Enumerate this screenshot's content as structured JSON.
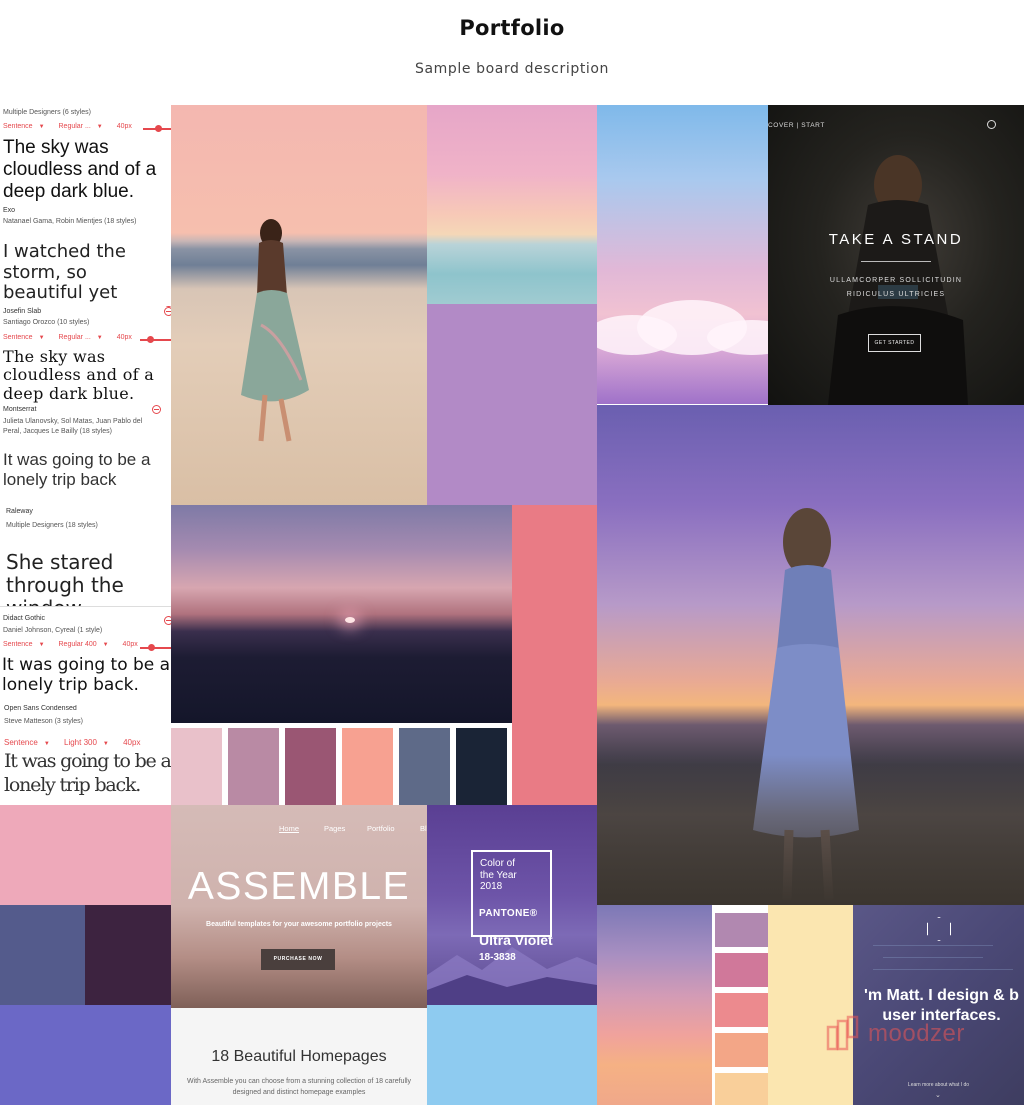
{
  "board": {
    "title": "Portfolio",
    "description": "Sample board description"
  },
  "font_panel": {
    "fonts": [
      {
        "name": "",
        "designers": "Multiple Designers (6 styles)",
        "case": "Sentence",
        "weight": "Regular ...",
        "size": "40px",
        "sample": "The sky was cloudless and of a deep dark blue."
      },
      {
        "name": "Exo",
        "designers": "Natanael Gama, Robin Mientjes (18 styles)",
        "case": "",
        "weight": "",
        "size": "",
        "sample": "I watched the storm, so beautiful yet"
      },
      {
        "name": "Josefin Slab",
        "designers": "Santiago Orozco (10 styles)",
        "case": "Sentence",
        "weight": "Regular ...",
        "size": "40px",
        "sample": "The sky was cloudless and of a deep dark blue."
      },
      {
        "name": "Montserrat",
        "designers": "Julieta Ulanovsky, Sol Matas, Juan Pablo del Peral, Jacques Le Bailly (18 styles)",
        "case": "",
        "weight": "",
        "size": "",
        "sample": "It was going to be a lonely trip back"
      },
      {
        "name": "Raleway",
        "designers": "Multiple Designers (18 styles)",
        "case": "",
        "weight": "",
        "size": "",
        "sample": "She stared through the window"
      },
      {
        "name": "Didact Gothic",
        "designers": "Daniel Johnson, Cyreal (1 style)",
        "case": "Sentence",
        "weight": "Regular 400",
        "size": "40px",
        "sample": "It was going to be a lonely trip back."
      },
      {
        "name": "Open Sans Condensed",
        "designers": "Steve Matteson (3 styles)",
        "case": "Sentence",
        "weight": "Light 300",
        "size": "40px",
        "sample": "It was going to be a lonely trip back."
      }
    ]
  },
  "take_a_stand": {
    "nav": "COVER | START",
    "title": "TAKE A STAND",
    "subtitle_1": "ULLAMCORPER SOLLICITUDIN",
    "subtitle_2": "RIDICULUS ULTRICIES",
    "button": "GET STARTED"
  },
  "assemble": {
    "nav": [
      "Home",
      "Pages",
      "Portfolio",
      "Bl"
    ],
    "title": "ASSEMBLE",
    "tagline": "Beautiful templates for your awesome portfolio projects",
    "button": "PURCHASE NOW",
    "homepages_title": "18 Beautiful Homepages",
    "homepages_desc": "With Assemble you can choose from a stunning collection of 18 carefully designed and distinct homepage examples"
  },
  "pantone": {
    "cy": "Color of\nthe Year\n2018",
    "brand": "PANTONE®",
    "color_name": "Ultra Violet",
    "code": "18-3838"
  },
  "matt": {
    "headline": "'m Matt. I design & b\nuser interfaces.",
    "more": "Learn more about what I do"
  },
  "watermark": {
    "text": "moodzer"
  },
  "palettes": {
    "dusk": [
      "#e9c1ca",
      "#b98aa4",
      "#9a5673",
      "#f7a191",
      "#5e6a88",
      "#1a2436"
    ],
    "sunset": [
      "#b188b0",
      "#d0789a",
      "#ec8a8e",
      "#f3a687",
      "#f9cf9a"
    ],
    "tiles": {
      "lilac": "#b28ac6",
      "salmon": "#e97b85",
      "pink": "#eea9ba",
      "slate": "#545b8c",
      "plum": "#3d2340",
      "iris": "#6b68c6",
      "sky_blue": "#8ecbf0",
      "cream": "#fbe6b0"
    },
    "accent": "#e5484d"
  }
}
